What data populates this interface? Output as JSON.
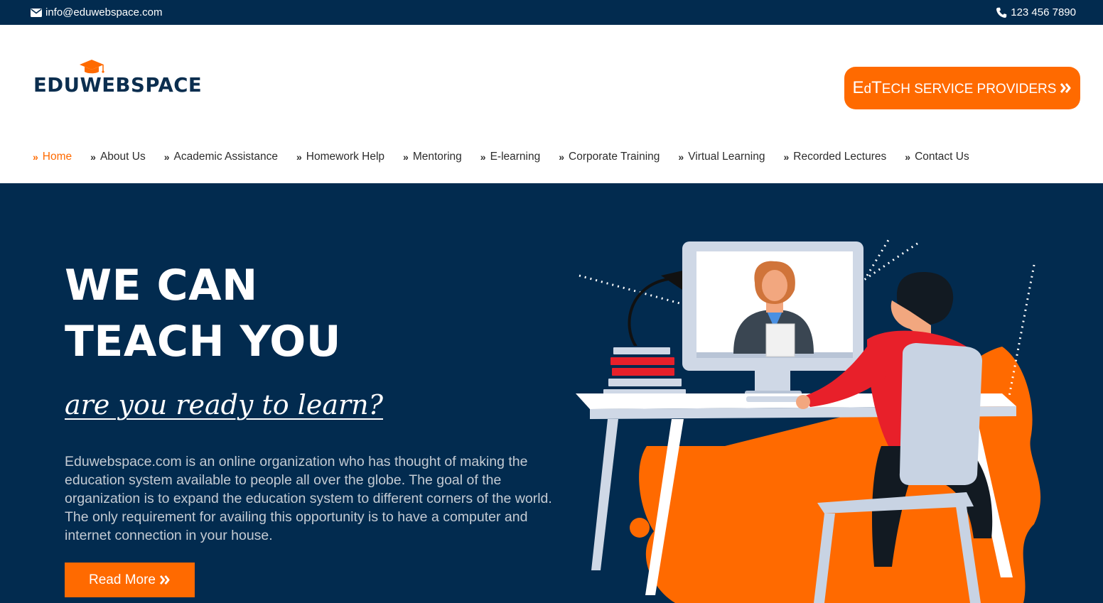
{
  "topbar": {
    "email": "info@eduwebspace.com",
    "phone": "123 456 7890"
  },
  "header": {
    "logo_text": "EDUWEBSPACE",
    "cta_first_ed": "E",
    "cta_d": "d",
    "cta_t": "T",
    "cta_rest": "ECH SERVICE PROVIDERS",
    "cta_icon": "double-chevron-right-icon"
  },
  "nav": {
    "items": [
      {
        "label": "Home",
        "active": true
      },
      {
        "label": "About Us"
      },
      {
        "label": "Academic Assistance"
      },
      {
        "label": "Homework Help"
      },
      {
        "label": "Mentoring"
      },
      {
        "label": "E-learning"
      },
      {
        "label": "Corporate Training"
      },
      {
        "label": "Virtual Learning"
      },
      {
        "label": "Recorded Lectures"
      },
      {
        "label": "Contact Us"
      }
    ],
    "chevron": "»"
  },
  "hero": {
    "title_line1": "WE CAN",
    "title_line2": "TEACH YOU",
    "tagline": "are you ready to learn?",
    "description": "Eduwebspace.com is an online organization who has thought of making the education system available to people all over the globe. The goal of the organization is to expand the education system to different corners of the world. The only requirement for availing this opportunity is to have a computer and internet connection in your house.",
    "button_label": "Read More",
    "button_icon": "»",
    "illustration": "student-at-computer-video-lesson-illustration"
  },
  "colors": {
    "navy": "#022b4f",
    "orange": "#ff6a00",
    "white": "#ffffff"
  }
}
